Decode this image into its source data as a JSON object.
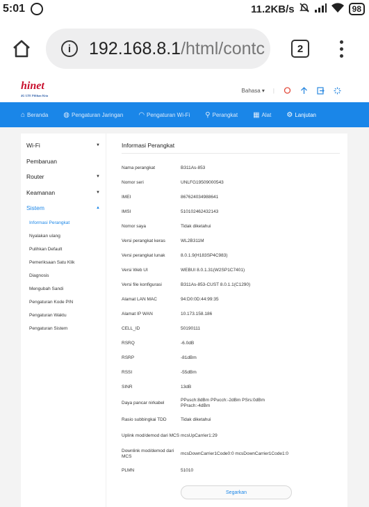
{
  "status_bar": {
    "time": "5:01",
    "net_speed": "11.2KB/s",
    "battery": "98"
  },
  "browser": {
    "url_main": "192.168.8.1",
    "url_path": "/html/contс",
    "tab_count": "2"
  },
  "header": {
    "logo_text": "hinet",
    "logo_tagline": "4G LTE Pilihan Kita",
    "language": "Bahasa",
    "accent_color": "#1a86e8"
  },
  "nav": {
    "items": [
      {
        "label": "Beranda",
        "icon": "home-icon"
      },
      {
        "label": "Pengaturan Jaringan",
        "icon": "globe-icon"
      },
      {
        "label": "Pengaturan Wi-Fi",
        "icon": "wifi-icon"
      },
      {
        "label": "Perangkat",
        "icon": "devices-icon"
      },
      {
        "label": "Alat",
        "icon": "tools-icon"
      },
      {
        "label": "Lanjutan",
        "icon": "gear-icon"
      }
    ]
  },
  "sidebar": {
    "sections": [
      {
        "label": "Wi-Fi"
      },
      {
        "label": "Pembaruan"
      },
      {
        "label": "Router"
      },
      {
        "label": "Keamanan"
      },
      {
        "label": "Sistem"
      }
    ],
    "subitems": [
      {
        "label": "Informasi Perangkat"
      },
      {
        "label": "Nyalakan ulang"
      },
      {
        "label": "Pulihkan Default"
      },
      {
        "label": "Pemeriksaan Satu Klik"
      },
      {
        "label": "Diagnosis"
      },
      {
        "label": "Mengubah Sandi"
      },
      {
        "label": "Pengaturan Kode PIN"
      },
      {
        "label": "Pengaturan Waktu"
      },
      {
        "label": "Pengaturan Sistem"
      }
    ]
  },
  "main": {
    "title": "Informasi Perangkat",
    "rows": [
      {
        "key": "Nama perangkat",
        "value": "B311As-853"
      },
      {
        "key": "Nomor seri",
        "value": "UNLFG19509000543"
      },
      {
        "key": "IMEI",
        "value": "867624034988641"
      },
      {
        "key": "IMSI",
        "value": "510102462432143"
      },
      {
        "key": "Nomor saya",
        "value": "Tidak diketahui"
      },
      {
        "key": "Versi perangkat keras",
        "value": "WL2B311M"
      },
      {
        "key": "Versi perangkat lunak",
        "value": "8.0.1.9(H183SP4C983)"
      },
      {
        "key": "Versi Web UI",
        "value": "WEBUI 8.0.1.31(W2SP1C7401)"
      },
      {
        "key": "Versi file konfigurasi",
        "value": "B311As-853-CUST 8.0.1.1(C1290)"
      },
      {
        "key": "Alamat LAN MAC",
        "value": "94:D0:0D:44:99:35"
      },
      {
        "key": "Alamat IP WAN",
        "value": "10.173.158.186"
      },
      {
        "key": "CELL_ID",
        "value": "50190111"
      },
      {
        "key": "RSRQ",
        "value": "-6.0dB"
      },
      {
        "key": "RSRP",
        "value": "-81dBm"
      },
      {
        "key": "RSSI",
        "value": "-55dBm"
      },
      {
        "key": "SINR",
        "value": "13dB"
      },
      {
        "key": "Daya pancar nirkabel",
        "value": "PPusch:8dBm PPucch:-2dBm PSrs:0dBm PPrach:-4dBm"
      },
      {
        "key": "Rasio subbingkai TDD",
        "value": "Tidak diketahui"
      },
      {
        "key": "Uplink mod/demod dari MCS",
        "value": "mcsUpCarrier1:29"
      },
      {
        "key": "Downlink mod/demod dari MCS",
        "value": "mcsDownCarrier1Code0:0 mcsDownCarrier1Code1:0"
      },
      {
        "key": "PLMN",
        "value": "51010"
      }
    ],
    "refresh_label": "Segarkan"
  }
}
